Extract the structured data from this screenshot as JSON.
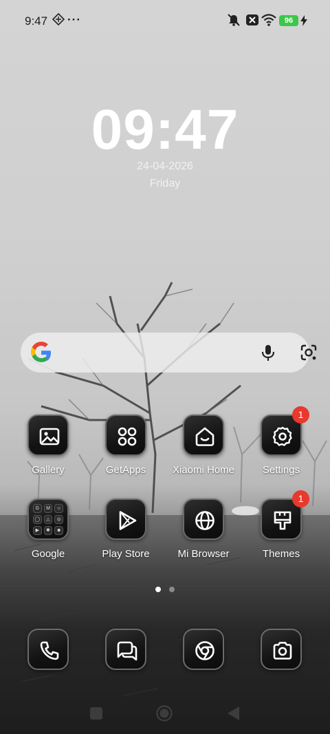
{
  "status_bar": {
    "time": "9:47",
    "more_dots": "···",
    "battery_level": "96",
    "battery_color": "#3cc74a"
  },
  "clock": {
    "time": "09:47",
    "date": "24-04-2026",
    "day": "Friday"
  },
  "search_bar": {
    "logo": "google-g-icon",
    "mic": "mic-icon",
    "lens": "google-lens-icon"
  },
  "apps": [
    {
      "label": "Gallery",
      "icon": "image-icon",
      "badge": ""
    },
    {
      "label": "GetApps",
      "icon": "four-circles-icon",
      "badge": ""
    },
    {
      "label": "Xiaomi Home",
      "icon": "home-icon",
      "badge": ""
    },
    {
      "label": "Settings",
      "icon": "gear-icon",
      "badge": "1"
    },
    {
      "label": "Google",
      "icon": "folder-icon",
      "badge": ""
    },
    {
      "label": "Play Store",
      "icon": "play-icon",
      "badge": ""
    },
    {
      "label": "Mi Browser",
      "icon": "globe-icon",
      "badge": ""
    },
    {
      "label": "Themes",
      "icon": "brush-icon",
      "badge": "1"
    }
  ],
  "pager": {
    "pages": 2,
    "current": 1
  },
  "dock": [
    {
      "icon": "phone-icon"
    },
    {
      "icon": "messages-icon"
    },
    {
      "icon": "chrome-icon"
    },
    {
      "icon": "camera-icon"
    }
  ],
  "nav_bar": {
    "items": [
      "recents-icon",
      "home-icon",
      "back-icon"
    ]
  },
  "colors": {
    "badge": "#e9382c",
    "accent_text": "#ffffff"
  }
}
